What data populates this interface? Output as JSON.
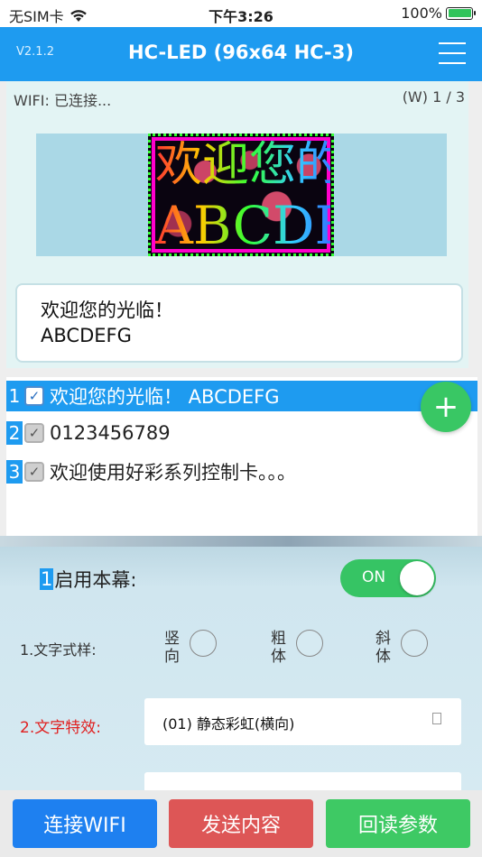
{
  "status_bar": {
    "carrier": "无SIM卡",
    "time": "下午3:26",
    "battery": "100%",
    "battery_level": 1.0
  },
  "navbar": {
    "version": "V2.1.2",
    "title": "HC-LED (96x64 HC-3)"
  },
  "preview": {
    "wifi_status": "WIFI: 已连接...",
    "page_counter": "(W) 1 / 3",
    "led_line1": "欢迎您的光临",
    "led_line2": "ABCDEFG",
    "content_line1": "欢迎您的光临！",
    "content_line2": "ABCDEFG"
  },
  "programs": [
    {
      "num": "1",
      "text": "欢迎您的光临！  ABCDEFG",
      "checked": true
    },
    {
      "num": "2",
      "text": "0123456789",
      "checked": true
    },
    {
      "num": "3",
      "text": "欢迎使用好彩系列控制卡。。。",
      "checked": true
    }
  ],
  "add_button": "+",
  "settings": {
    "enable_num": "1",
    "enable_label": "启用本幕:",
    "toggle_label": "ON",
    "toggle_on": true,
    "text_style_label": "1.文字式样:",
    "style_options": [
      {
        "line1": "竖",
        "line2": "向"
      },
      {
        "line1": "粗",
        "line2": "体"
      },
      {
        "line1": "斜",
        "line2": "体"
      }
    ],
    "effect_label": "2.文字特效:",
    "effect_value": "(01) 静态彩虹(横向)"
  },
  "bottom": {
    "connect": "连接WIFI",
    "send": "发送内容",
    "read": "回读参数"
  },
  "colors": {
    "accent": "#1e9bf0",
    "add_green": "#39c764",
    "send_red": "#dd5656",
    "effect_label_red": "#e02020"
  }
}
